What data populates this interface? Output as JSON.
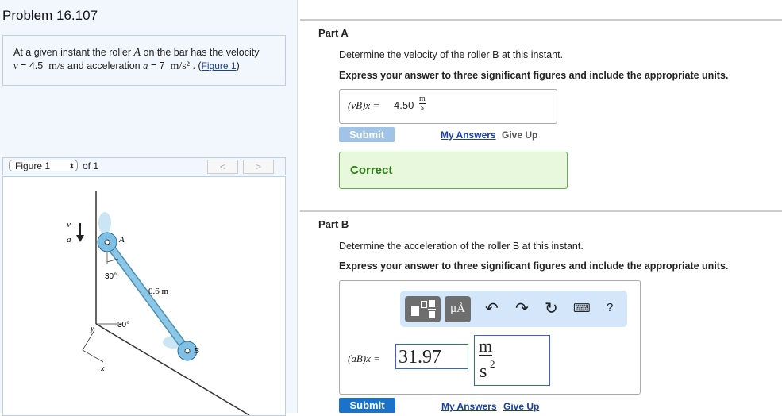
{
  "problem": {
    "title": "Problem 16.107",
    "text1": "At a given instant the roller",
    "rollerA": "A",
    "text2": "on the bar has the velocity",
    "v_sym": "v",
    "v_eq": "= 4.5",
    "v_unit": "m/s",
    "text3": "and acceleration",
    "a_sym": "a",
    "a_eq": "= 7",
    "a_unit": "m/s²",
    "dot": ".",
    "figure_link": "Figure 1"
  },
  "figure_nav": {
    "select": "Figure 1",
    "of": "of 1",
    "prev": "<",
    "next": ">"
  },
  "figure": {
    "v": "v",
    "a": "a",
    "A": "A",
    "B": "B",
    "angle1": "30°",
    "length": "0.6 m",
    "angle2": "30°",
    "y": "y",
    "x": "x"
  },
  "partA": {
    "title": "Part A",
    "question": "Determine the velocity of the roller B at this instant.",
    "instruction": "Express your answer to three significant figures and include the appropriate units.",
    "label": "(vB)x =",
    "value": "4.50",
    "unit_num": "m",
    "unit_den": "s",
    "submit": "Submit",
    "my_answers": "My Answers",
    "give_up": "Give Up",
    "feedback": "Correct"
  },
  "partB": {
    "title": "Part B",
    "question": "Determine the acceleration of the roller B at this instant.",
    "instruction": "Express your answer to three significant figures and include the appropriate units.",
    "label": "(aB)x =",
    "value": "31.97",
    "unit_num": "m",
    "unit_den": "s",
    "unit_exp": "2",
    "units_btn": "μÅ",
    "help": "?",
    "submit": "Submit",
    "my_answers": "My Answers",
    "give_up": "Give Up"
  }
}
